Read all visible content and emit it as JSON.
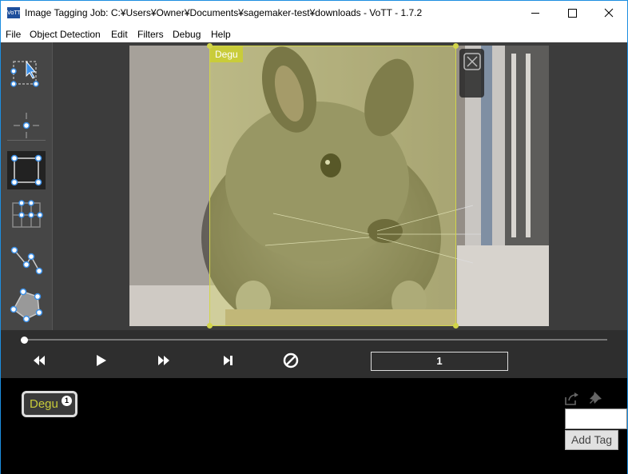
{
  "window": {
    "title": "Image Tagging Job: C:¥Users¥Owner¥Documents¥sagemaker-test¥downloads - VoTT - 1.7.2",
    "app_icon_text": "VoTT"
  },
  "menu": {
    "items": [
      "File",
      "Object Detection",
      "Edit",
      "Filters",
      "Debug",
      "Help"
    ]
  },
  "toolbar": {
    "tools": [
      {
        "icon": "select-pointer-icon"
      },
      {
        "icon": "point-icon"
      },
      {
        "icon": "rectangle-icon",
        "active": true
      },
      {
        "icon": "grid-select-icon"
      },
      {
        "icon": "polyline-icon"
      },
      {
        "icon": "polygon-icon"
      }
    ]
  },
  "region": {
    "label": "Degu",
    "color": "#d2d54a"
  },
  "playback": {
    "frame": "1"
  },
  "tags": {
    "items": [
      {
        "name": "Degu",
        "count": "1"
      }
    ],
    "input_value": "",
    "add_tag_label": "Add Tag"
  },
  "colors": {
    "tag": "#c9cc3a",
    "accent": "#1c8ee0",
    "tool_blue": "#3a8fe8"
  }
}
